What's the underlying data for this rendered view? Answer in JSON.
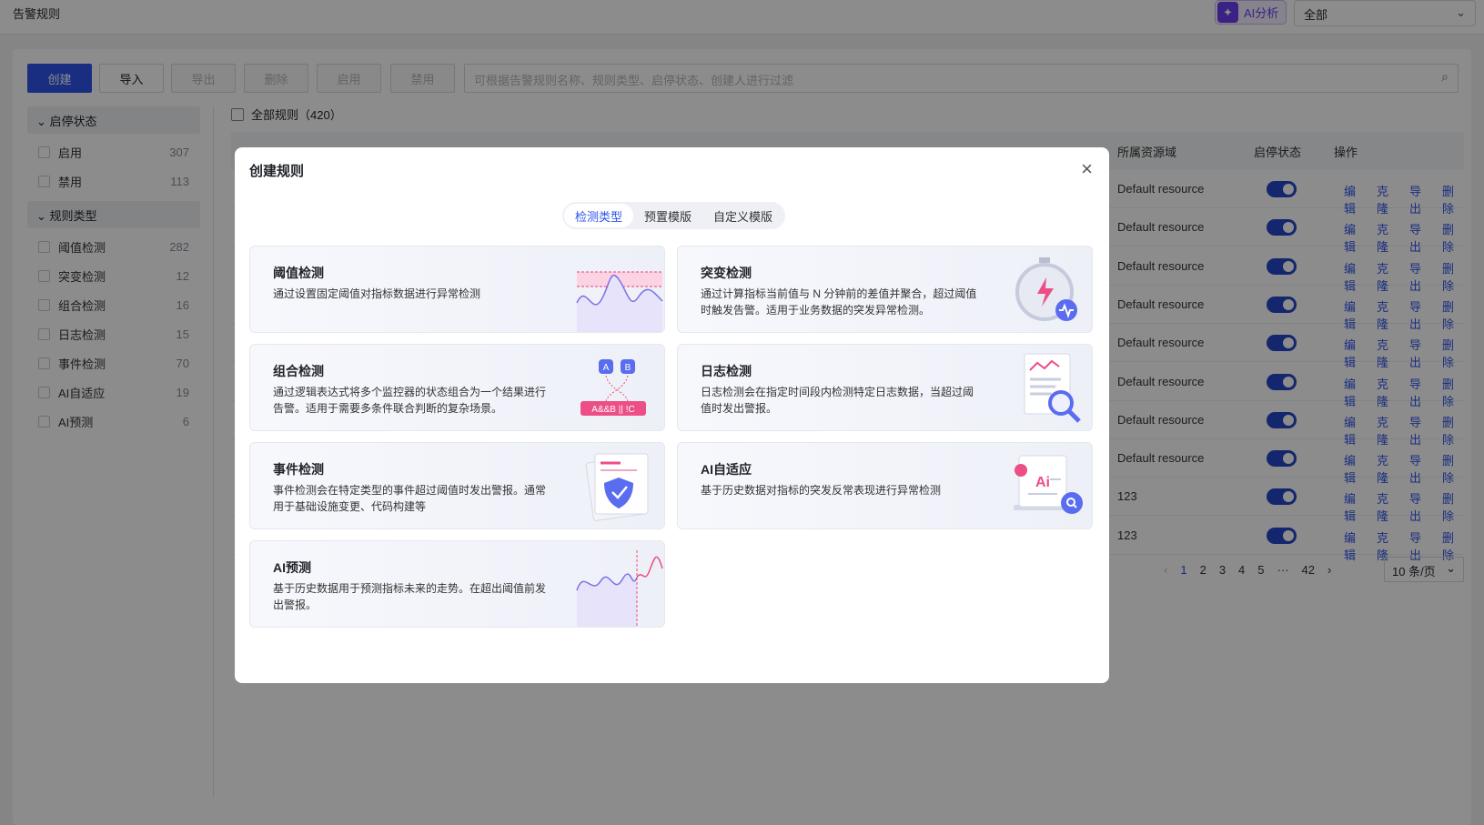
{
  "topbar": {
    "title": "告警规则",
    "ai_label": "AI分析",
    "scope": "全部"
  },
  "toolbar": {
    "create": "创建",
    "import": "导入",
    "export": "导出",
    "delete": "删除",
    "enable": "启用",
    "disable": "禁用",
    "search_placeholder": "可根据告警规则名称、规则类型、启停状态、创建人进行过滤"
  },
  "sidebar": {
    "status_group": "启停状态",
    "status_items": [
      {
        "label": "启用",
        "count": "307"
      },
      {
        "label": "禁用",
        "count": "113"
      }
    ],
    "type_group": "规则类型",
    "type_items": [
      {
        "label": "阈值检测",
        "count": "282"
      },
      {
        "label": "突变检测",
        "count": "12"
      },
      {
        "label": "组合检测",
        "count": "16"
      },
      {
        "label": "日志检测",
        "count": "15"
      },
      {
        "label": "事件检测",
        "count": "70"
      },
      {
        "label": "AI自适应",
        "count": "19"
      },
      {
        "label": "AI预测",
        "count": "6"
      }
    ]
  },
  "list": {
    "header": "全部规则（420）",
    "columns": {
      "resource": "所属资源域",
      "status": "启停状态",
      "actions": "操作"
    },
    "rows": [
      {
        "resource": "Default resource"
      },
      {
        "resource": "Default resource"
      },
      {
        "resource": "Default resource"
      },
      {
        "resource": "Default resource"
      },
      {
        "resource": "Default resource"
      },
      {
        "resource": "Default resource"
      },
      {
        "resource": "Default resource"
      },
      {
        "resource": "Default resource"
      },
      {
        "resource": "123"
      },
      {
        "resource": "123"
      }
    ],
    "row_actions": {
      "edit": "编辑",
      "clone": "克隆",
      "export": "导出",
      "delete": "删除"
    },
    "pager": {
      "pages": [
        "1",
        "2",
        "3",
        "4",
        "5",
        "···",
        "42"
      ],
      "page_size": "10 条/页"
    }
  },
  "modal": {
    "title": "创建规则",
    "tabs": [
      "检测类型",
      "预置模版",
      "自定义模版"
    ],
    "cards": [
      {
        "title": "阈值检测",
        "desc": "通过设置固定阈值对指标数据进行异常检测"
      },
      {
        "title": "突变检测",
        "desc": "通过计算指标当前值与 N 分钟前的差值并聚合，超过阈值时触发告警。适用于业务数据的突发异常检测。"
      },
      {
        "title": "组合检测",
        "desc": "通过逻辑表达式将多个监控器的状态组合为一个结果进行告警。适用于需要多条件联合判断的复杂场景。"
      },
      {
        "title": "日志检测",
        "desc": "日志检测会在指定时间段内检测特定日志数据，当超过阈值时发出警报。"
      },
      {
        "title": "事件检测",
        "desc": "事件检测会在特定类型的事件超过阈值时发出警报。通常用于基础设施变更、代码构建等"
      },
      {
        "title": "AI自适应",
        "desc": "基于历史数据对指标的突发反常表现进行异常检测"
      },
      {
        "title": "AI预测",
        "desc": "基于历史数据用于预测指标未来的走势。在超出阈值前发出警报。"
      }
    ],
    "illustrations": {
      "combo_a": "A",
      "combo_b": "B",
      "combo_expr": "A&&B || !C",
      "ai_text": "Ai"
    }
  }
}
